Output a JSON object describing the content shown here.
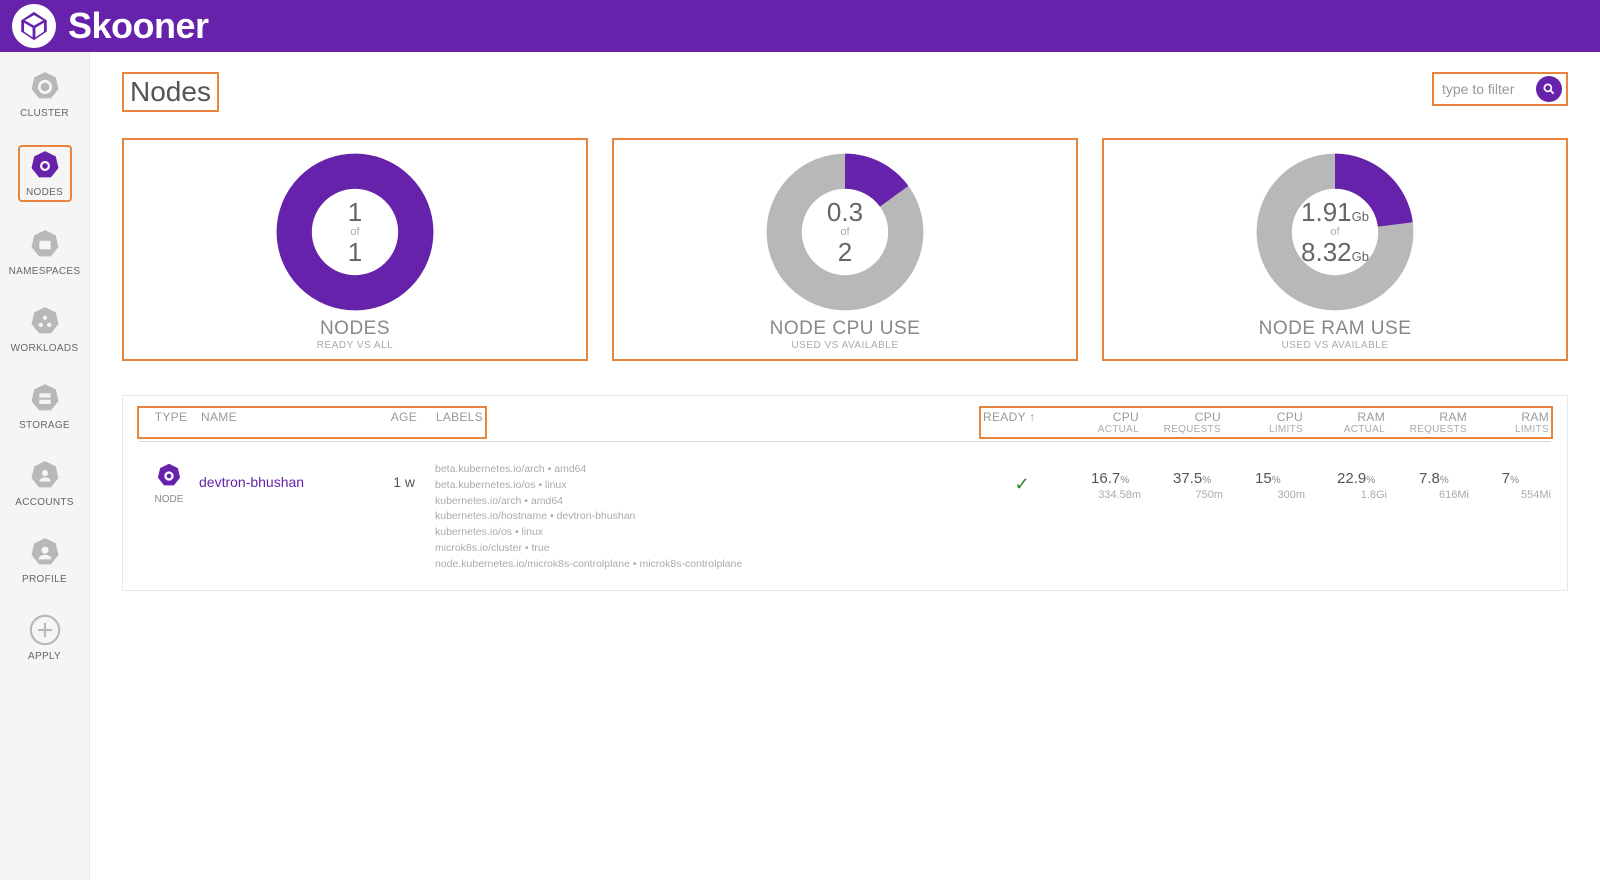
{
  "app": {
    "name": "Skooner"
  },
  "colors": {
    "brand": "#6622aa",
    "highlight": "#e8853c",
    "gray": "#b8b8b8"
  },
  "sidebar": {
    "items": [
      {
        "label": "CLUSTER",
        "icon": "wheel-icon"
      },
      {
        "label": "NODES",
        "icon": "node-icon"
      },
      {
        "label": "NAMESPACES",
        "icon": "namespace-icon"
      },
      {
        "label": "WORKLOADS",
        "icon": "workload-icon"
      },
      {
        "label": "STORAGE",
        "icon": "storage-icon"
      },
      {
        "label": "ACCOUNTS",
        "icon": "account-icon"
      },
      {
        "label": "PROFILE",
        "icon": "profile-icon"
      },
      {
        "label": "APPLY",
        "icon": "plus-icon"
      }
    ],
    "active_index": 1
  },
  "page": {
    "title": "Nodes",
    "filter": {
      "placeholder": "type to filter",
      "value": ""
    }
  },
  "chart_data": [
    {
      "type": "pie",
      "title": "NODES",
      "subtitle": "READY VS ALL",
      "top": "1",
      "top_unit": "",
      "mid": "of",
      "bot": "1",
      "bot_unit": "",
      "pct": 100
    },
    {
      "type": "pie",
      "title": "NODE CPU USE",
      "subtitle": "USED VS AVAILABLE",
      "top": "0.3",
      "top_unit": "",
      "mid": "of",
      "bot": "2",
      "bot_unit": "",
      "pct": 15
    },
    {
      "type": "pie",
      "title": "NODE RAM USE",
      "subtitle": "USED VS AVAILABLE",
      "top": "1.91",
      "top_unit": "Gb",
      "mid": "of",
      "bot": "8.32",
      "bot_unit": "Gb",
      "pct": 23
    }
  ],
  "table": {
    "headers": {
      "type": "TYPE",
      "name": "NAME",
      "age": "AGE",
      "labels": "LABELS",
      "ready": "READY",
      "cpu_actual": "CPU",
      "cpu_actual_sub": "ACTUAL",
      "cpu_requests": "CPU",
      "cpu_requests_sub": "REQUESTS",
      "cpu_limits": "CPU",
      "cpu_limits_sub": "LIMITS",
      "ram_actual": "RAM",
      "ram_actual_sub": "ACTUAL",
      "ram_requests": "RAM",
      "ram_requests_sub": "REQUESTS",
      "ram_limits": "RAM",
      "ram_limits_sub": "LIMITS"
    },
    "rows": [
      {
        "type_label": "NODE",
        "name": "devtron-bhushan",
        "age": "1 w",
        "labels": "beta.kubernetes.io/arch • amd64\nbeta.kubernetes.io/os • linux\nkubernetes.io/arch • amd64\nkubernetes.io/hostname • devtron-bhushan\nkubernetes.io/os • linux\nmicrok8s.io/cluster • true\nnode.kubernetes.io/microk8s-controlplane • microk8s-controlplane",
        "ready": "✓",
        "cpu_actual": {
          "pct": "16.7",
          "val": "334.58m"
        },
        "cpu_requests": {
          "pct": "37.5",
          "val": "750m"
        },
        "cpu_limits": {
          "pct": "15",
          "val": "300m"
        },
        "ram_actual": {
          "pct": "22.9",
          "val": "1.8Gi"
        },
        "ram_requests": {
          "pct": "7.8",
          "val": "616Mi"
        },
        "ram_limits": {
          "pct": "7",
          "val": "554Mi"
        }
      }
    ]
  }
}
